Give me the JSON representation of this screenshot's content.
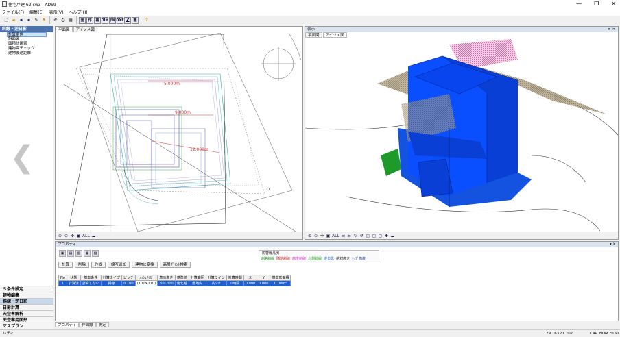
{
  "window": {
    "title": "住宅戸建 62.cw3 - ADS9",
    "controls": [
      "—",
      "❐",
      "✕"
    ]
  },
  "menu": [
    "ファイル(F)",
    "編集(E)",
    "表示(V)",
    "ヘルプ(H)"
  ],
  "toolbar": {
    "labeled_buttons": [
      "面",
      "作",
      "補",
      "DIM",
      "JW",
      "DXF",
      "Z",
      "離"
    ]
  },
  "left_panel": {
    "header": "斜線・逆日影",
    "items": [
      "計算条件",
      "斜面図",
      "面積計画表",
      "建物高チェック",
      "建物後退距離"
    ],
    "selected_index": 0,
    "bottom_items": [
      "５条件設定",
      "建物編集",
      "斜線・逆日影",
      "日影計算",
      "天空率解析",
      "天空率用図形",
      "マスプラン"
    ],
    "bottom_selected_index": 2
  },
  "plan_view": {
    "tabs": [
      "平面図",
      "アイソメ図"
    ],
    "active_tab": 0,
    "contour_labels": [
      "5.000m",
      "9.000m",
      "12.000m"
    ]
  },
  "iso_view": {
    "title": "表示",
    "tabs": [
      "平面図",
      "アイソメ図"
    ],
    "active_tab": 1,
    "controls": "▾ ✕"
  },
  "view_toolbar_left": [
    "⊕",
    "⊖",
    "✣",
    "▣",
    "ALL",
    "☁"
  ],
  "view_toolbar_right": [
    "⊕",
    "⊖",
    "✣",
    "▣",
    "ALL",
    "⇉",
    "⇇",
    "↻",
    "↺",
    "▢",
    "▢",
    "▢",
    "✚",
    "☁"
  ],
  "properties": {
    "title": "プロパティ",
    "controls": "▾ ✕",
    "buttons": [
      "計算",
      "削除",
      "作成",
      "線写追加",
      "建物に変換",
      "高層ﾎﾟｲﾝﾄ検索"
    ],
    "legend": {
      "title": "影響線凡例",
      "entries": [
        {
          "label": "道路斜線",
          "color": "#1a8c1a"
        },
        {
          "label": "隣地斜線",
          "color": "#d21e1e"
        },
        {
          "label": "高度斜線",
          "color": "#d226d2"
        },
        {
          "label": "北側斜線",
          "color": "#1fa01f"
        },
        {
          "label": "逆日影",
          "color": "#2a6fd6"
        },
        {
          "label": "絶対高さ",
          "color": "#222222"
        },
        {
          "label": "ﾄｯﾌﾟ高度",
          "color": "#1a3fa8"
        }
      ]
    },
    "columns": [
      "No",
      "状態",
      "基本条件",
      "計算タイプ",
      "ピッチ",
      "ﾒｯｼｭｻｲｽﾞ",
      "表示高さ",
      "基準値",
      "計算範囲",
      "計算ライン",
      "計算時間",
      "X",
      "Y",
      "基本形面積"
    ],
    "rows": [
      [
        "1",
        "計算済",
        "計算しない",
        "斜線",
        "0.100",
        "(101×110)",
        "200.000",
        "南北軸",
        "敷地内",
        "内ｼﾝﾁ",
        "0時間",
        "0.000",
        "0.000",
        "0.00m²"
      ]
    ]
  },
  "bottom_tabs": [
    "プロパティ",
    "作図線",
    "測定"
  ],
  "status": {
    "left": "レディ",
    "coord_x": "29.163",
    "coord_y": "21.707",
    "indicators": [
      "CAP",
      "NUM",
      "SCRL"
    ]
  }
}
